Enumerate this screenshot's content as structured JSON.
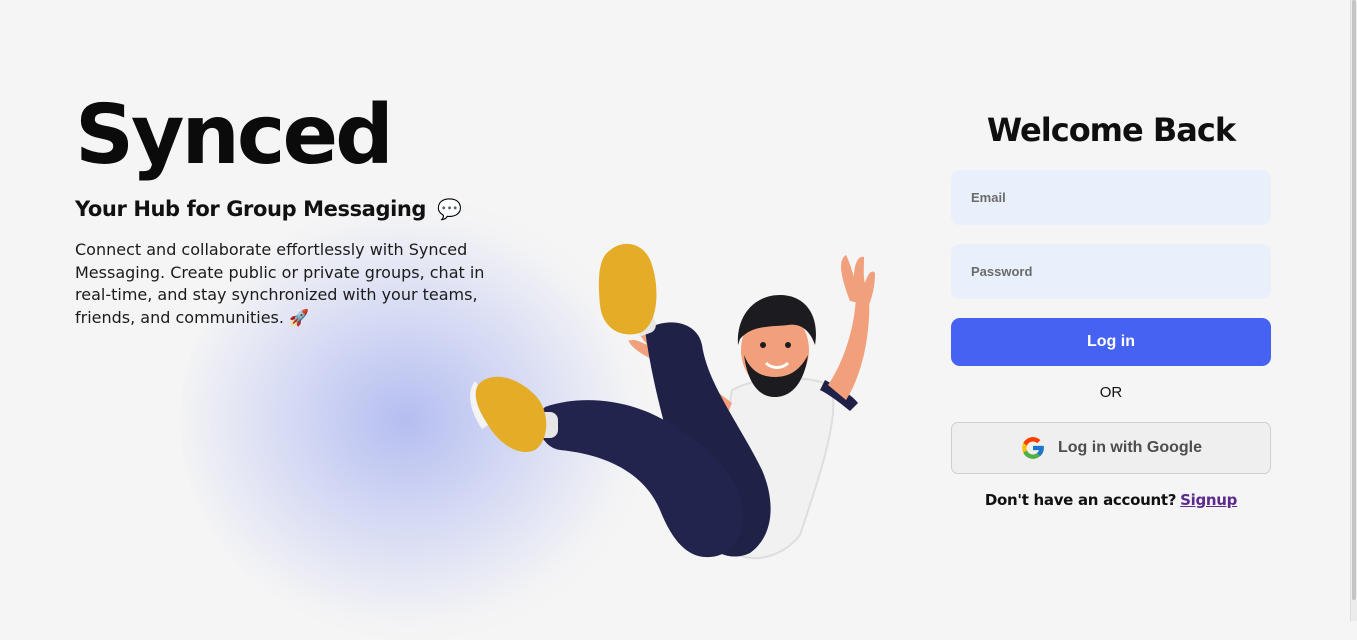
{
  "hero": {
    "brand": "Synced",
    "tagline": "Your Hub for Group Messaging",
    "tagline_emoji": "💬",
    "description": "Connect and collaborate effortlessly with Synced Messaging. Create public or private groups, chat in real-time, and stay synchronized with your teams, friends, and communities.",
    "description_emoji": "🚀"
  },
  "login": {
    "title": "Welcome Back",
    "email_placeholder": "Email",
    "password_placeholder": "Password",
    "login_label": "Log in",
    "divider": "OR",
    "google_label": "Log in with Google",
    "signup_prompt": "Don't have an account?",
    "signup_link": "Signup"
  },
  "colors": {
    "primary": "#4562f2",
    "input_bg": "#e9f0fb",
    "page_bg": "#f5f5f5",
    "link": "#5b2a8c"
  },
  "icons": {
    "google": "google-logo-icon",
    "chat": "speech-bubble-icon",
    "rocket": "rocket-icon"
  }
}
